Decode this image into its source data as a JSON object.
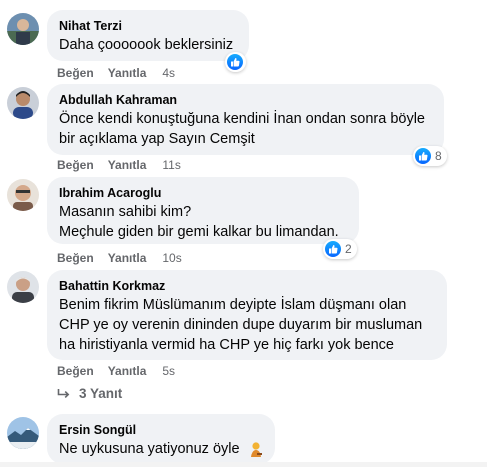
{
  "actions": {
    "like": "Beğen",
    "reply": "Yanıtla"
  },
  "colors": {
    "like_blue": "#0866ff",
    "bubble": "#f0f2f5",
    "meta_gray": "#65676b"
  },
  "comments": [
    {
      "author": "Nihat Terzi",
      "lines": [
        "Daha çooooook beklersiniz"
      ],
      "time": "4s",
      "reactions": {
        "icon": "like-icon",
        "count": ""
      }
    },
    {
      "author": "Abdullah Kahraman",
      "lines": [
        "Önce kendi konuştuğuna kendini İnan ondan sonra böyle",
        "bir açıklama yap Sayın Cemşit"
      ],
      "time": "11s",
      "reactions": {
        "icon": "like-icon",
        "count": "8"
      }
    },
    {
      "author": "Ibrahim Acaroglu",
      "lines": [
        "Masanın sahibi kim?",
        "Meçhule giden bir gemi kalkar bu limandan."
      ],
      "time": "10s",
      "reactions": {
        "icon": "like-icon",
        "count": "2"
      }
    },
    {
      "author": "Bahattin Korkmaz",
      "lines": [
        "Benim fikrim Müslümanım deyipte İslam düşmanı olan",
        "CHP ye oy verenin dininden dupe duyarım bir musluman",
        "ha hiristiyanla vermid ha CHP ye hiç farkı yok bence"
      ],
      "time": "5s",
      "reactions": null,
      "replies": "3 Yanıt"
    },
    {
      "author": "Ersin Songül",
      "lines": [
        "Ne uykusuna yatiyonuz öyle"
      ],
      "time": "",
      "reactions": null,
      "emoji": "person-emoji-icon"
    }
  ]
}
